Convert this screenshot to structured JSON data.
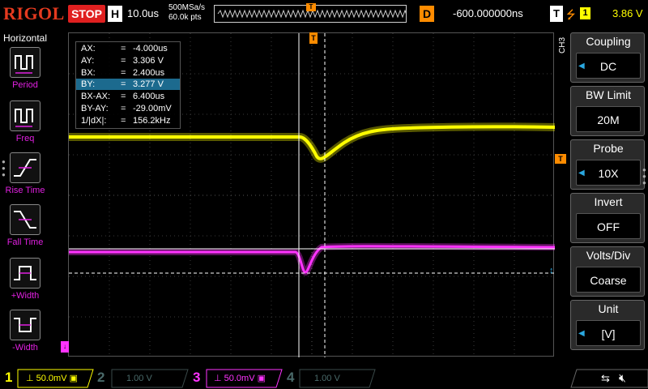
{
  "header": {
    "brand": "RIGOL",
    "run_state": "STOP",
    "h_label": "H",
    "timebase": "10.0us",
    "sample_rate": "500MSa/s",
    "memory_depth": "60.0k pts",
    "trig_pos_marker": "T",
    "delay_label": "D",
    "delay": "-600.000000ns",
    "trigger_label": "T",
    "trigger_source": "1",
    "trigger_level": "3.86 V"
  },
  "left_panel": {
    "title": "Horizontal",
    "items": [
      {
        "label": "Period",
        "icon": "period-icon"
      },
      {
        "label": "Freq",
        "icon": "frequency-icon"
      },
      {
        "label": "Rise Time",
        "icon": "rise-time-icon"
      },
      {
        "label": "Fall Time",
        "icon": "fall-time-icon"
      },
      {
        "label": "+Width",
        "icon": "positive-width-icon"
      },
      {
        "label": "-Width",
        "icon": "negative-width-icon"
      }
    ]
  },
  "cursors": [
    {
      "key": "AX:",
      "value": "-4.000us"
    },
    {
      "key": "AY:",
      "value": "3.306 V"
    },
    {
      "key": "BX:",
      "value": "2.400us"
    },
    {
      "key": "BY:",
      "value": "3.277 V"
    },
    {
      "key": "BX-AX:",
      "value": "6.400us"
    },
    {
      "key": "BY-AY:",
      "value": "-29.00mV"
    },
    {
      "key": "1/|dX|:",
      "value": "156.2kHz"
    }
  ],
  "cursor_eq": "=",
  "right_panel": {
    "channel_tag": "CH3",
    "buttons": [
      {
        "title": "Coupling",
        "value": "DC",
        "arrow": true
      },
      {
        "title": "BW Limit",
        "value": "20M",
        "arrow": false
      },
      {
        "title": "Probe",
        "value": "10X",
        "arrow": true
      },
      {
        "title": "Invert",
        "value": "OFF",
        "arrow": false
      },
      {
        "title": "Volts/Div",
        "value": "Coarse",
        "arrow": false
      },
      {
        "title": "Unit",
        "value": "[V]",
        "arrow": true
      }
    ]
  },
  "channels": [
    {
      "num": "1",
      "scale": "50.0mV",
      "color": "#ffff00",
      "active": true
    },
    {
      "num": "2",
      "scale": "1.00 V",
      "color": "#4a6a6a",
      "active": false
    },
    {
      "num": "3",
      "scale": "50.0mV",
      "color": "#ff33ff",
      "active": true
    },
    {
      "num": "4",
      "scale": "1.00 V",
      "color": "#4a6a6a",
      "active": false
    }
  ],
  "colors": {
    "ch1": "#ffff00",
    "ch3": "#ff33ff",
    "trigger": "#ff8c00",
    "cursor_select": "#1c6a8e",
    "accent_arrow": "#2aa8e0"
  }
}
